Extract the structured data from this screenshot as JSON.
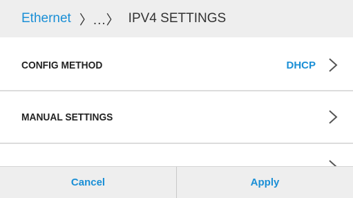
{
  "breadcrumb": {
    "root": "Ethernet",
    "separator": "〉...〉",
    "current": "IPV4 SETTINGS"
  },
  "rows": [
    {
      "label": "CONFIG METHOD",
      "value": "DHCP",
      "icon": "chevron-right-icon"
    },
    {
      "label": "MANUAL SETTINGS",
      "value": "",
      "icon": "chevron-right-icon"
    }
  ],
  "footer": {
    "cancel_label": "Cancel",
    "apply_label": "Apply"
  },
  "colors": {
    "accent": "#1a8fd6",
    "header_bg": "#eeeeee",
    "text": "#222222"
  }
}
